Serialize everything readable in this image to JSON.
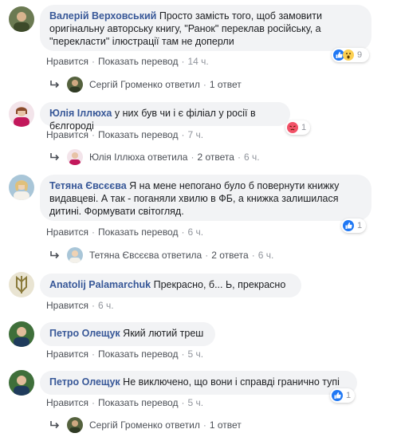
{
  "colors": {
    "author_link": "#385898",
    "bubble_bg": "#f2f3f5",
    "like_blue": "#2078f4",
    "angry_orange": "#f25268"
  },
  "comments": [
    {
      "author": "Валерій Верховський",
      "text": "Просто замість того, щоб замовити оригінальну авторську книгу, \"Ранок\" переклав російську, а \"перекласти\" ілюстрації там не доперли",
      "actions": {
        "like": "Нравится",
        "translate": "Показать перевод",
        "time": "14 ч."
      },
      "reactions": {
        "icons": [
          "like-icon",
          "wow-icon"
        ],
        "count": "9"
      },
      "reply": {
        "name": "Сергій Громенко ответил",
        "count": "1 ответ",
        "time": ""
      }
    },
    {
      "author": "Юлія Іллюха",
      "text": "у них був чи і є філіал у росії в бєлгороді",
      "actions": {
        "like": "Нравится",
        "translate": "Показать перевод",
        "time": "7 ч."
      },
      "reactions": {
        "icons": [
          "angry-icon"
        ],
        "count": "1"
      },
      "reply": {
        "name": "Юлія Іллюха ответила",
        "count": "2 ответа",
        "time": "6 ч."
      }
    },
    {
      "author": "Тетяна Євсєєва",
      "text": "Я на мене непогано було б повернути книжку видавцеві. А так - поганяли хвилю в ФБ, а книжка залишилася дитині. Формувати світогляд.",
      "actions": {
        "like": "Нравится",
        "translate": "Показать перевод",
        "time": "6 ч."
      },
      "reactions": {
        "icons": [
          "like-icon"
        ],
        "count": "1"
      },
      "reply": {
        "name": "Тетяна Євсєєва ответила",
        "count": "2 ответа",
        "time": "6 ч."
      }
    },
    {
      "author": "Anatolij Palamarchuk",
      "text": "Прекрасно, б... Ь, прекрасно",
      "actions": {
        "like": "Нравится",
        "time": "6 ч."
      }
    },
    {
      "author": "Петро Олещук",
      "text": "Який лютий треш",
      "actions": {
        "like": "Нравится",
        "translate": "Показать перевод",
        "time": "5 ч."
      }
    },
    {
      "author": "Петро Олещук",
      "text": "Не виключено, що вони і справді гранично тупі",
      "actions": {
        "like": "Нравится",
        "translate": "Показать перевод",
        "time": "5 ч."
      },
      "reactions": {
        "icons": [
          "like-icon"
        ],
        "count": "1"
      },
      "reply": {
        "name": "Сергій Громенко ответил",
        "count": "1 ответ",
        "time": ""
      }
    }
  ]
}
